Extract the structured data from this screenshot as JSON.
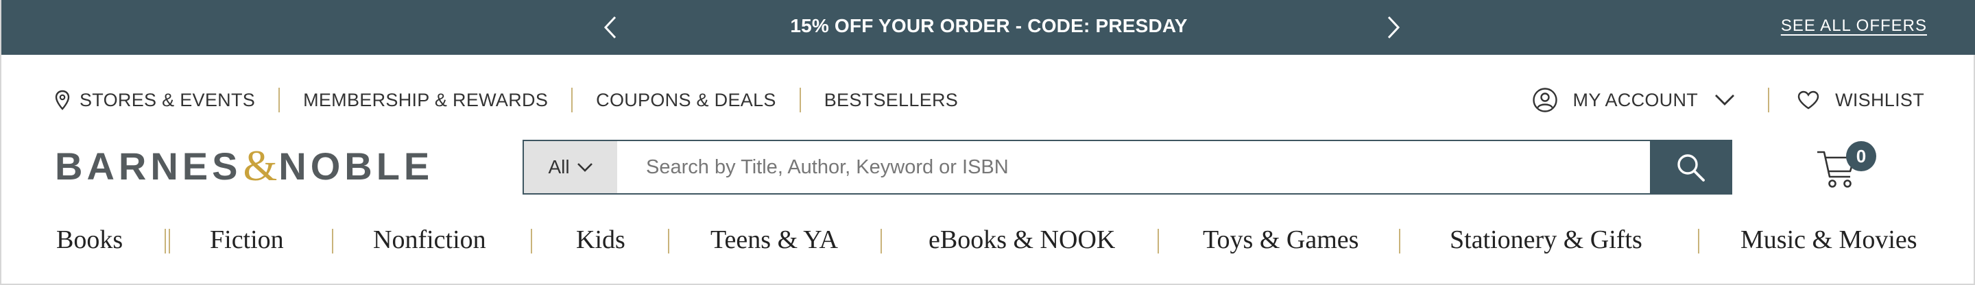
{
  "promo": {
    "text": "15% OFF YOUR ORDER - CODE: PRESDAY",
    "see_all_label": "SEE ALL OFFERS",
    "prev_icon": "chevron-left-icon",
    "next_icon": "chevron-right-icon"
  },
  "utility_nav": {
    "items": [
      {
        "label": "STORES & EVENTS",
        "icon": "map-pin-icon"
      },
      {
        "label": "MEMBERSHIP & REWARDS"
      },
      {
        "label": "COUPONS & DEALS"
      },
      {
        "label": "BESTSELLERS"
      }
    ]
  },
  "account": {
    "my_account_label": "MY ACCOUNT",
    "wishlist_label": "WISHLIST"
  },
  "logo": {
    "left": "BARNES",
    "amp": "&",
    "right": "NOBLE"
  },
  "search": {
    "category": "All",
    "placeholder": "Search by Title, Author, Keyword or ISBN",
    "value": ""
  },
  "cart": {
    "count": "0"
  },
  "categories": [
    "Books",
    "Fiction",
    "Nonfiction",
    "Kids",
    "Teens & YA",
    "eBooks & NOOK",
    "Toys & Games",
    "Stationery & Gifts",
    "Music & Movies"
  ],
  "colors": {
    "brand_dark": "#3e5661",
    "accent_gold": "#c9a23c",
    "separator": "#c9b37a"
  }
}
